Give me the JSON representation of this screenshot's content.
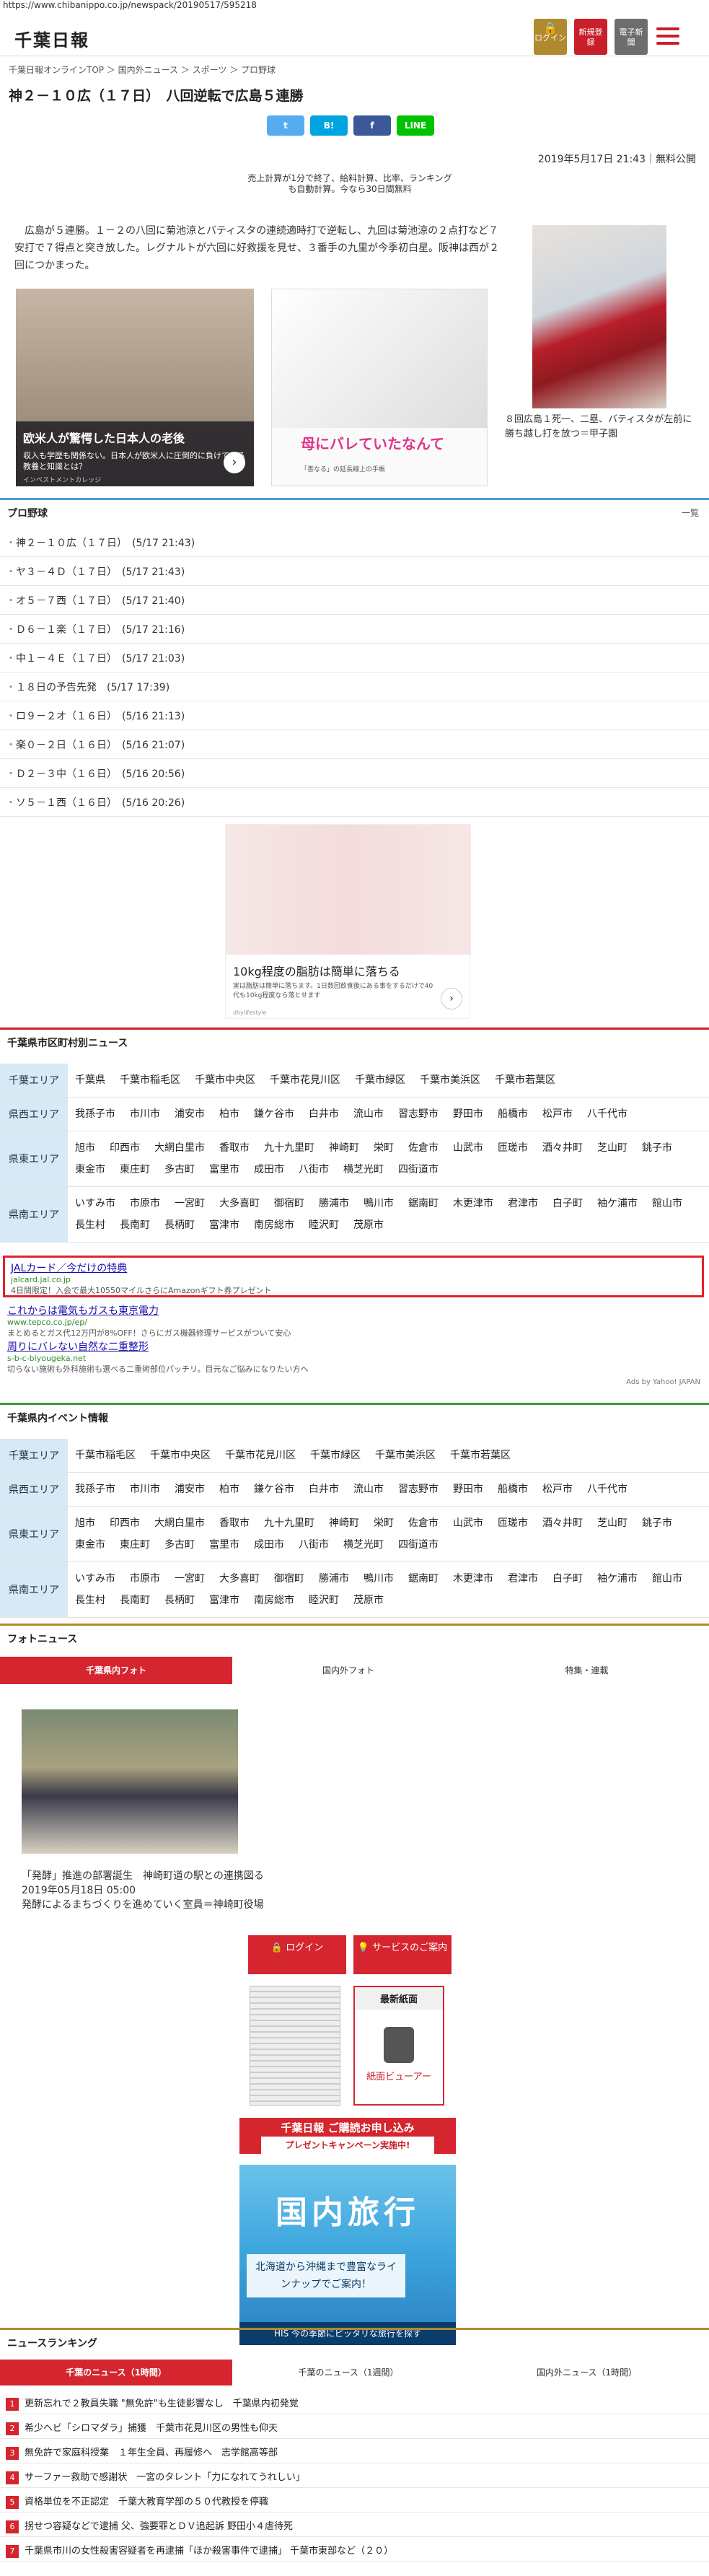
{
  "url": "https://www.chibanippo.co.jp/newspack/20190517/595218",
  "header": {
    "logo": "千葉日報",
    "login": "ログイン",
    "register": "新規登録",
    "epaper": "電子新聞"
  },
  "breadcrumb": "千葉日報オンラインTOP ＞ 国内外ニュース ＞ スポーツ ＞ プロ野球",
  "article": {
    "title": "神２－１０広（１７日）　八回逆転で広島５連勝",
    "share": {
      "twitter": "t",
      "hatena": "B!",
      "facebook": "f",
      "line": "LINE"
    },
    "date": "2019年5月17日 21:43｜無料公開",
    "ad_text": "売上計算が1分で終了、給料計算、比率、ランキングも自動計算。今なら30日間無料",
    "lead": "　広島が５連勝。１－２の八回に菊池涼とバティスタの連続適時打で逆転し、九回は菊池涼の２点打など７安打で７得点と突き放した。レグナルトが六回に好救援を見せ、３番手の九里が今季初白星。阪神は西が２回につかまった。",
    "caption": "８回広島１死一、二塁、バティスタが左前に勝ち越し打を放つ＝甲子園"
  },
  "ads_inline": {
    "card1_title": "欧米人が驚愕した日本人の老後",
    "card1_text": "収入も学歴も関係ない。日本人が欧米人に圧倒的に負けている教養と知識とは？",
    "card1_source": "インベストメントカレッジ",
    "card2_title": "母にバレていたなんて",
    "card2_source": "「善なる」の延長線上の手帳"
  },
  "baseball": {
    "heading": "プロ野球",
    "more": "一覧",
    "items": [
      "神２－１０広（１７日）　(5/17 21:43)",
      "ヤ３－４Ｄ（１７日）　(5/17 21:43)",
      "オ５－７西（１７日）　(5/17 21:40)",
      "Ｄ６－１楽（１７日）　(5/17 21:16)",
      "中１－４Ｅ（１７日）　(5/17 21:03)",
      "１８日の予告先発　(5/17 17:39)",
      "ロ９－２オ（１６日）　(5/16 21:13)",
      "楽０－２日（１６日）　(5/16 21:07)",
      "Ｄ２－３中（１６日）　(5/16 20:56)",
      "ソ５－１西（１６日）　(5/16 20:26)"
    ]
  },
  "ad_mid": {
    "title": "10kg程度の脂肪は簡単に落ちる",
    "text": "実は脂肪は簡単に落ちます。1日数回飲食後にある事をするだけで40代も10kg程度なら落とせます",
    "source": "dhylifestyle"
  },
  "city_news": {
    "heading": "千葉県市区町村別ニュース",
    "rows": [
      {
        "area": "千葉エリア",
        "cities": [
          "千葉県",
          "千葉市稲毛区",
          "千葉市中央区",
          "千葉市花見川区",
          "千葉市緑区",
          "千葉市美浜区",
          "千葉市若葉区"
        ]
      },
      {
        "area": "県西エリア",
        "cities": [
          "我孫子市",
          "市川市",
          "浦安市",
          "柏市",
          "鎌ケ谷市",
          "白井市",
          "流山市",
          "習志野市",
          "野田市",
          "船橋市",
          "松戸市",
          "八千代市"
        ]
      },
      {
        "area": "県東エリア",
        "cities": [
          "旭市",
          "印西市",
          "大網白里市",
          "香取市",
          "九十九里町",
          "神崎町",
          "栄町",
          "佐倉市",
          "山武市",
          "匝瑳市",
          "酒々井町",
          "芝山町",
          "銚子市",
          "東金市",
          "東庄町",
          "多古町",
          "富里市",
          "成田市",
          "八街市",
          "横芝光町",
          "四街道市"
        ]
      },
      {
        "area": "県南エリア",
        "cities": [
          "いすみ市",
          "市原市",
          "一宮町",
          "大多喜町",
          "御宿町",
          "勝浦市",
          "鴨川市",
          "鋸南町",
          "木更津市",
          "君津市",
          "白子町",
          "袖ケ浦市",
          "館山市",
          "長生村",
          "長南町",
          "長柄町",
          "富津市",
          "南房総市",
          "睦沢町",
          "茂原市"
        ]
      }
    ]
  },
  "yahoo_ads": [
    {
      "link": "JALカード／今だけの特典",
      "url": "jalcard.jal.co.jp",
      "desc": "4日間限定！入会で最大10550マイルさらにAmazonギフト券プレゼント"
    },
    {
      "link": "これからは電気もガスも東京電力",
      "url": "www.tepco.co.jp/ep/",
      "desc": "まとめるとガス代12万円が8%OFF！さらにガス機器修理サービスがついて安心"
    },
    {
      "link": "周りにバレない自然な二重整形",
      "url": "s-b-c-biyougeka.net",
      "desc": "切らない施術も外科施術も選べる二重術部位パッチリ。目元なご悩みになりたい方へ"
    }
  ],
  "yahoo_ads_by": "Ads by Yahoo! JAPAN",
  "events": {
    "heading": "千葉県内イベント情報",
    "rows": [
      {
        "area": "千葉エリア",
        "cities": [
          "千葉市稲毛区",
          "千葉市中央区",
          "千葉市花見川区",
          "千葉市緑区",
          "千葉市美浜区",
          "千葉市若葉区"
        ]
      },
      {
        "area": "県西エリア",
        "cities": [
          "我孫子市",
          "市川市",
          "浦安市",
          "柏市",
          "鎌ケ谷市",
          "白井市",
          "流山市",
          "習志野市",
          "野田市",
          "船橋市",
          "松戸市",
          "八千代市"
        ]
      },
      {
        "area": "県東エリア",
        "cities": [
          "旭市",
          "印西市",
          "大網白里市",
          "香取市",
          "九十九里町",
          "神崎町",
          "栄町",
          "佐倉市",
          "山武市",
          "匝瑳市",
          "酒々井町",
          "芝山町",
          "銚子市",
          "東金市",
          "東庄町",
          "多古町",
          "富里市",
          "成田市",
          "八街市",
          "横芝光町",
          "四街道市"
        ]
      },
      {
        "area": "県南エリア",
        "cities": [
          "いすみ市",
          "市原市",
          "一宮町",
          "大多喜町",
          "御宿町",
          "勝浦市",
          "鴨川市",
          "鋸南町",
          "木更津市",
          "君津市",
          "白子町",
          "袖ケ浦市",
          "館山市",
          "長生村",
          "長南町",
          "長柄町",
          "富津市",
          "南房総市",
          "睦沢町",
          "茂原市"
        ]
      }
    ]
  },
  "photo_news": {
    "heading": "フォトニュース",
    "tabs": [
      "千葉県内フォト",
      "国内外フォト",
      "特集・連載"
    ],
    "caption_title": "「発酵」推進の部署誕生　神崎町道の駅との連携図る",
    "caption_date": "2019年05月18日 05:00",
    "caption_text": "発酵によるまちづくりを進めていく室員＝神崎町役場"
  },
  "services": {
    "login": "ログイン",
    "service": "サービスのご案内",
    "latest": "最新紙面",
    "viewer": "紙面ビューアー",
    "banner1_line1": "千葉日報 ご購読お申し込み",
    "banner1_line2": "プレゼントキャンペーン実施中!",
    "banner2_title": "国内旅行",
    "banner2_text": "北海道から沖縄まで豊富なラインナップでご案内！",
    "banner2_footer": "HIS 今の季節にピッタリな旅行を探す"
  },
  "ranking": {
    "heading": "ニュースランキング",
    "tabs": [
      "千葉のニュース（1時間）",
      "千葉のニュース（1週間）",
      "国内外ニュース（1時間）"
    ],
    "items": [
      "更新忘れで２教員失職 \"無免許\"も生徒影響なし　千葉県内初発覚",
      "希少ヘビ「シロマダラ」捕獲　千葉市花見川区の男性も仰天",
      "無免許で家庭科授業　１年生全員、再履修へ　志学館高等部",
      "サーファー救助で感謝状　一宮のタレント「力になれてうれしい」",
      "資格単位を不正認定　千葉大教育学部の５０代教授を停職",
      "拐せつ容疑などで逮捕 父、強要罪とＤＶ追起訴 野田小４虐待死",
      "千葉県市川の女性殺害容疑者を再逮捕「ほか殺害事件で逮捕」 千葉市東部など（２０）"
    ]
  }
}
